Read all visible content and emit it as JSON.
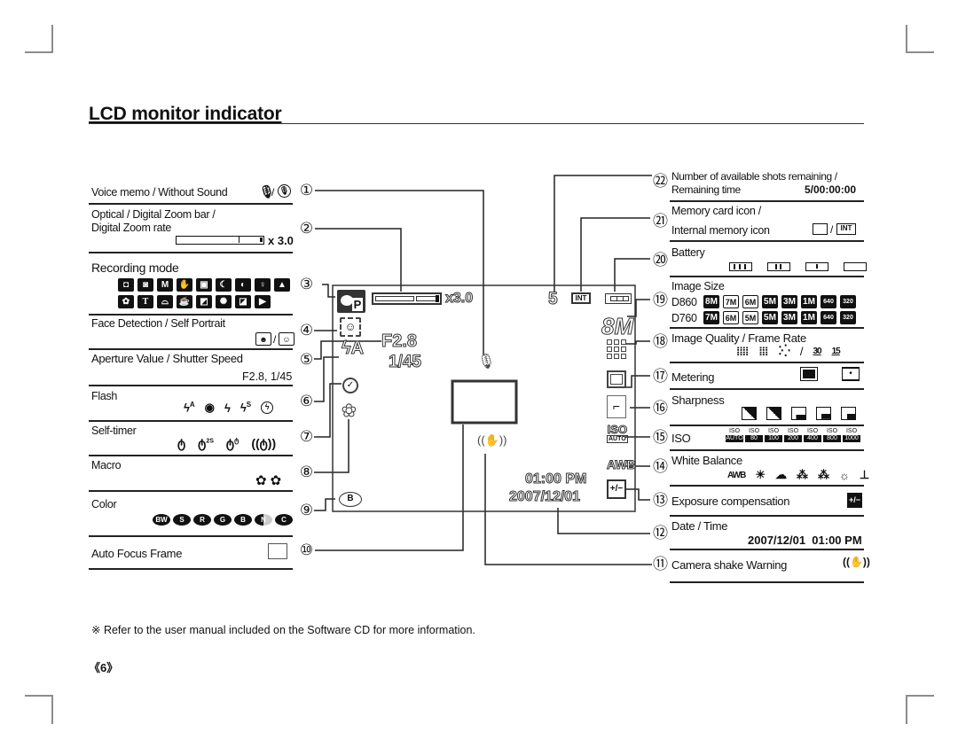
{
  "page": {
    "title": "LCD monitor indicator",
    "footnote": "※ Refer to the user manual included on the Software CD for more information.",
    "page_number": "《6》"
  },
  "left_items": [
    {
      "num": "①",
      "label": "Voice memo / Without Sound",
      "icons": [
        "microphone-icon",
        "/",
        "mute-microphone-icon"
      ]
    },
    {
      "num": "②",
      "label_line1": "Optical / Digital Zoom bar /",
      "label_line2": "Digital Zoom rate",
      "value": "x 3.0"
    },
    {
      "num": "③",
      "label": "Recording mode",
      "icons_row1": [
        "auto-camera",
        "program",
        "M",
        "dual-is",
        "photo-help",
        "night",
        "portrait-kids",
        "portrait",
        "landscape"
      ],
      "icons_row2": [
        "close-up",
        "T",
        "food",
        "cafe",
        "backlight",
        "fireworks",
        "beach-snow",
        "movie"
      ]
    },
    {
      "num": "④",
      "label": "Face Detection / Self Portrait",
      "icons": [
        "face-detection-icon",
        "/",
        "self-portrait-icon"
      ]
    },
    {
      "num": "⑤",
      "label": "Aperture Value / Shutter Speed",
      "value": "F2.8, 1/45"
    },
    {
      "num": "⑥",
      "label": "Flash",
      "icons": [
        "ϟA",
        "◉",
        "ϟ",
        "ϟS",
        "⊘"
      ]
    },
    {
      "num": "⑦",
      "label": "Self-timer",
      "icons": [
        "ტ",
        "ტ2S",
        "ტტ",
        "((ტ))"
      ]
    },
    {
      "num": "⑧",
      "label": "Macro",
      "icons": [
        "AF macro",
        "macro"
      ]
    },
    {
      "num": "⑨",
      "label": "Color",
      "icons": [
        "BW",
        "S",
        "R",
        "G",
        "B",
        "N",
        "C"
      ]
    },
    {
      "num": "⑩",
      "label": "Auto Focus Frame"
    }
  ],
  "right_items": [
    {
      "num": "㉒",
      "label_line1": "Number of available shots remaining /",
      "label_line2": "Remaining time",
      "value": "5/00:00:00"
    },
    {
      "num": "㉑",
      "label_line1": "Memory card icon /",
      "label_line2": "Internal memory icon",
      "icons": [
        "memory-card-icon",
        "/",
        "INT"
      ]
    },
    {
      "num": "⑳",
      "label": "Battery",
      "icons": [
        "battery-full",
        "battery-2",
        "battery-1",
        "battery-empty"
      ]
    },
    {
      "num": "⑲",
      "label": "Image Size",
      "rows": [
        {
          "model": "D860",
          "sizes": [
            "8M",
            "7M",
            "6M",
            "5M",
            "3M",
            "1M",
            "640",
            "320"
          ]
        },
        {
          "model": "D760",
          "sizes": [
            "7M",
            "6M",
            "5M",
            "5M",
            "3M",
            "1M",
            "640",
            "320"
          ]
        }
      ]
    },
    {
      "num": "⑱",
      "label": "Image Quality / Frame Rate",
      "icons": [
        "super-fine",
        "fine",
        "normal",
        "/",
        "30",
        "15"
      ]
    },
    {
      "num": "⑰",
      "label": "Metering",
      "icons": [
        "multi-metering",
        "spot-metering"
      ]
    },
    {
      "num": "⑯",
      "label": "Sharpness",
      "icons": [
        "soft-plus",
        "soft",
        "normal",
        "vivid",
        "vivid-plus"
      ]
    },
    {
      "num": "⑮",
      "label": "ISO",
      "iso_values": [
        "AUTO",
        "80",
        "100",
        "200",
        "400",
        "800",
        "1000"
      ],
      "iso_prefix": "ISO"
    },
    {
      "num": "⑭",
      "label": "White Balance",
      "icons": [
        "AWB",
        "daylight",
        "cloudy",
        "fluorescent-h",
        "fluorescent-l",
        "tungsten",
        "custom"
      ]
    },
    {
      "num": "⑬",
      "label": "Exposure compensation",
      "icons": [
        "exposure-comp-icon"
      ]
    },
    {
      "num": "⑫",
      "label": "Date / Time",
      "value": "2007/12/01  01:00 PM"
    },
    {
      "num": "⑪",
      "label": "Camera shake Warning",
      "icons": [
        "camera-shake-icon"
      ]
    }
  ],
  "lcd": {
    "zoom_rate": "x3.0",
    "zoom_level": 0.85,
    "aperture": "F2.8",
    "shutter": "1/45",
    "shots_remaining": "5",
    "memory": "INT",
    "time": "01:00 PM",
    "date": "2007/12/01",
    "image_size": "8M",
    "iso_top": "ISO",
    "iso_bottom": "AUTO",
    "wb": "AWB",
    "color_mode": "B",
    "mode_letter": "P"
  }
}
